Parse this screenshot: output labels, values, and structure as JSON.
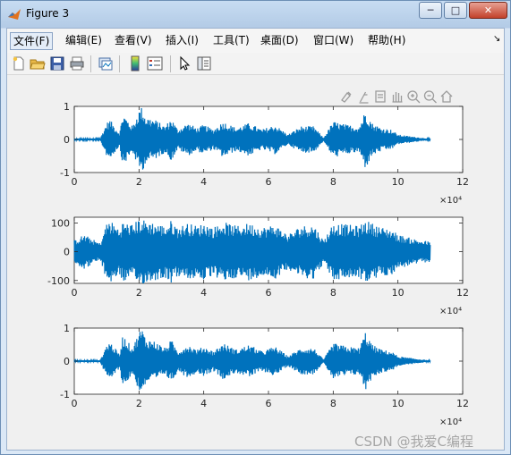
{
  "window": {
    "title": "Figure 3",
    "minimize_label": "─",
    "maximize_label": "□",
    "close_label": "✕"
  },
  "menu": {
    "items": [
      "文件(F)",
      "编辑(E)",
      "查看(V)",
      "插入(I)",
      "工具(T)",
      "桌面(D)",
      "窗口(W)",
      "帮助(H)"
    ],
    "selected": "文件(F)",
    "overflow_icon": "chevron-right-icon"
  },
  "toolbar": {
    "buttons": [
      "new-figure-icon",
      "open-file-icon",
      "save-icon",
      "print-icon",
      "link-plot-icon",
      "insert-colorbar-icon",
      "insert-legend-icon",
      "edit-plot-arrow-icon",
      "property-inspector-icon"
    ]
  },
  "axes_toolbar": {
    "buttons": [
      "brush-icon",
      "data-tips-icon",
      "export-icon",
      "pan-hand-icon",
      "zoom-in-icon",
      "zoom-out-icon",
      "home-icon"
    ]
  },
  "colors": {
    "signal": "#0072bd",
    "axes_bg": "#ffffff",
    "figure_bg": "#f0f0f0"
  },
  "chart_data": [
    {
      "type": "line",
      "x_ticks": [
        "0",
        "2",
        "4",
        "6",
        "8",
        "10",
        "12"
      ],
      "x_exponent": "×10⁴",
      "xlim": [
        0,
        120000
      ],
      "y_ticks": [
        "-1",
        "0",
        "1"
      ],
      "ylim": [
        -1,
        1
      ],
      "title": "",
      "xlabel": "",
      "ylabel": "",
      "approx_envelope": {
        "x": [
          0,
          8000,
          10000,
          11000,
          14000,
          15000,
          18000,
          20000,
          21000,
          22000,
          25000,
          28000,
          30000,
          32000,
          35000,
          38000,
          40000,
          43000,
          46000,
          50000,
          54000,
          58000,
          62000,
          66000,
          70000,
          74000,
          77000,
          80000,
          84000,
          88000,
          90000,
          92000,
          95000,
          98000,
          100000,
          105000,
          110000
        ],
        "amplitude": [
          0.03,
          0.03,
          0.5,
          0.6,
          0.2,
          0.8,
          0.4,
          0.9,
          1.0,
          0.7,
          0.6,
          0.4,
          0.65,
          0.3,
          0.5,
          0.35,
          0.45,
          0.3,
          0.55,
          0.35,
          0.5,
          0.3,
          0.45,
          0.15,
          0.4,
          0.4,
          0.05,
          0.55,
          0.45,
          0.4,
          0.9,
          0.5,
          0.35,
          0.3,
          0.15,
          0.08,
          0.02
        ]
      }
    },
    {
      "type": "line",
      "x_ticks": [
        "0",
        "2",
        "4",
        "6",
        "8",
        "10",
        "12"
      ],
      "x_exponent": "×10⁴",
      "xlim": [
        0,
        120000
      ],
      "y_ticks": [
        "100",
        "0",
        "-100"
      ],
      "ylim": [
        -110,
        120
      ],
      "title": "",
      "xlabel": "",
      "ylabel": "",
      "approx_envelope": {
        "x": [
          0,
          3000,
          8000,
          10000,
          11000,
          14000,
          15000,
          18000,
          20000,
          22000,
          25000,
          28000,
          30000,
          32000,
          35000,
          38000,
          40000,
          43000,
          46000,
          50000,
          54000,
          58000,
          62000,
          66000,
          70000,
          74000,
          77000,
          80000,
          84000,
          88000,
          90000,
          92000,
          95000,
          98000,
          100000,
          105000,
          110000
        ],
        "amplitude": [
          40,
          60,
          30,
          100,
          110,
          80,
          105,
          95,
          115,
          110,
          100,
          90,
          110,
          85,
          100,
          90,
          100,
          85,
          105,
          90,
          100,
          85,
          95,
          60,
          90,
          95,
          40,
          100,
          95,
          90,
          110,
          100,
          85,
          80,
          60,
          45,
          35
        ]
      }
    },
    {
      "type": "line",
      "x_ticks": [
        "0",
        "2",
        "4",
        "6",
        "8",
        "10",
        "12"
      ],
      "x_exponent": "×10⁴",
      "xlim": [
        0,
        120000
      ],
      "y_ticks": [
        "-1",
        "0",
        "1"
      ],
      "ylim": [
        -1,
        1
      ],
      "title": "",
      "xlabel": "",
      "ylabel": "",
      "approx_envelope": {
        "x": [
          0,
          8000,
          10000,
          11000,
          14000,
          15000,
          18000,
          20000,
          21000,
          22000,
          25000,
          28000,
          30000,
          32000,
          35000,
          38000,
          40000,
          43000,
          46000,
          50000,
          54000,
          58000,
          62000,
          66000,
          70000,
          74000,
          77000,
          80000,
          84000,
          88000,
          90000,
          92000,
          95000,
          98000,
          100000,
          105000,
          110000
        ],
        "amplitude": [
          0.03,
          0.03,
          0.5,
          0.6,
          0.2,
          0.8,
          0.4,
          0.9,
          1.0,
          0.7,
          0.6,
          0.4,
          0.65,
          0.3,
          0.5,
          0.35,
          0.45,
          0.3,
          0.55,
          0.35,
          0.5,
          0.3,
          0.45,
          0.15,
          0.4,
          0.4,
          0.05,
          0.55,
          0.45,
          0.4,
          0.9,
          0.5,
          0.35,
          0.3,
          0.15,
          0.08,
          0.02
        ]
      }
    }
  ],
  "watermark": "CSDN @我爱C编程"
}
